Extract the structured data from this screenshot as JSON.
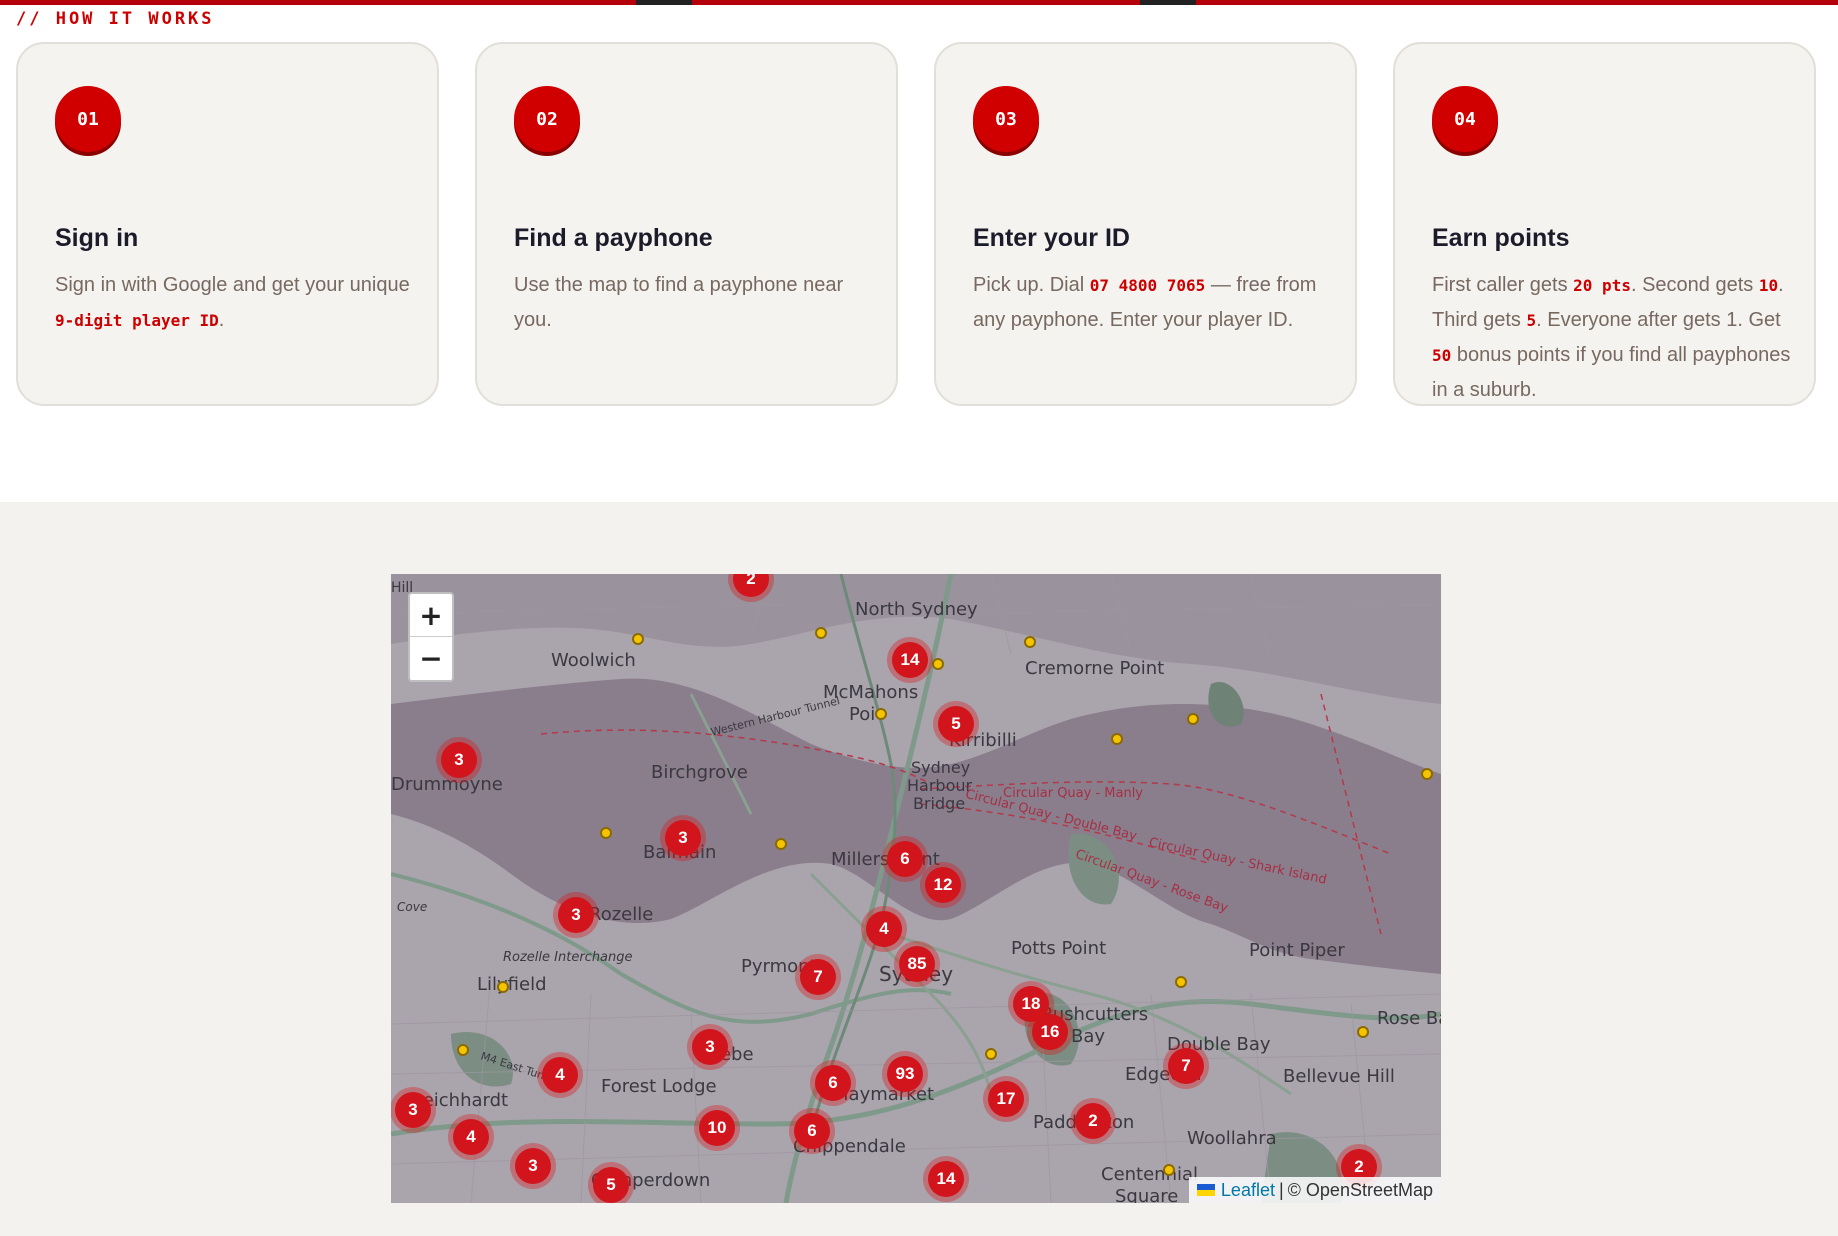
{
  "eyebrow": "// HOW IT WORKS",
  "steps": [
    {
      "number": "01",
      "title": "Sign in",
      "text_a": "Sign in with Google and get your unique ",
      "code_a": "9-digit player ID",
      "text_b": "."
    },
    {
      "number": "02",
      "title": "Find a payphone",
      "text_a": "Use the map to find a payphone near you."
    },
    {
      "number": "03",
      "title": "Enter your ID",
      "text_a": "Pick up. Dial ",
      "code_a": "07 4800 7065",
      "text_b": " — free from any payphone. Enter your player ID."
    },
    {
      "number": "04",
      "title": "Earn points",
      "text_a": "First caller gets ",
      "code_a": "20 pts",
      "text_b": ". Second gets ",
      "code_b": "10",
      "text_c": ". Third gets ",
      "code_c": "5",
      "text_d": ". Everyone after gets 1. Get ",
      "code_d": "50",
      "text_e": " bonus points if you find all payphones in a suburb."
    }
  ],
  "map": {
    "zoom_in": "+",
    "zoom_out": "−",
    "attribution_link": "Leaflet",
    "attribution_sep": "|",
    "attribution_text": "© OpenStreetMap",
    "labels": [
      "North Sydney",
      "Woolwich",
      "McMahons",
      "Poi",
      "Cremorne Point",
      "Kirribilli",
      "Birchgrove",
      "Sydney",
      "Harbour",
      "Bridge",
      "Drummoyne",
      "Balmain",
      "Millers Point",
      "Rozelle",
      "Rozelle Interchange",
      "Lilyfield",
      "Pyrmont",
      "Sydney",
      "Potts Point",
      "Point Piper",
      "Rushcutters",
      "Bay",
      "Double Bay",
      "Rose Ba",
      "Glebe",
      "Forest Lodge",
      "Haymarket",
      "Leichhardt",
      "Edgecliff",
      "Bellevue Hill",
      "Paddington",
      "Chippendale",
      "Woollahra",
      "Camperdown",
      "Centennial",
      "Square",
      "Western Harbour Tunnel",
      "M4 East Tunnel",
      "Circular Quay - Manly",
      "Circular Quay - Double Bay",
      "Circular Quay - Shark Island",
      "Circular Quay - Rose Bay",
      "Cove",
      "Hill"
    ],
    "clusters": [
      "2",
      "14",
      "5",
      "3",
      "3",
      "6",
      "12",
      "3",
      "4",
      "85",
      "7",
      "18",
      "16",
      "3",
      "93",
      "17",
      "7",
      "6",
      "4",
      "3",
      "4",
      "10",
      "6",
      "2",
      "3",
      "5",
      "14",
      "2"
    ]
  },
  "colors": {
    "accent": "#cc0000",
    "badge": "#d10000",
    "card_bg": "#f4f3f0",
    "section_bg": "#f3f2ef"
  }
}
